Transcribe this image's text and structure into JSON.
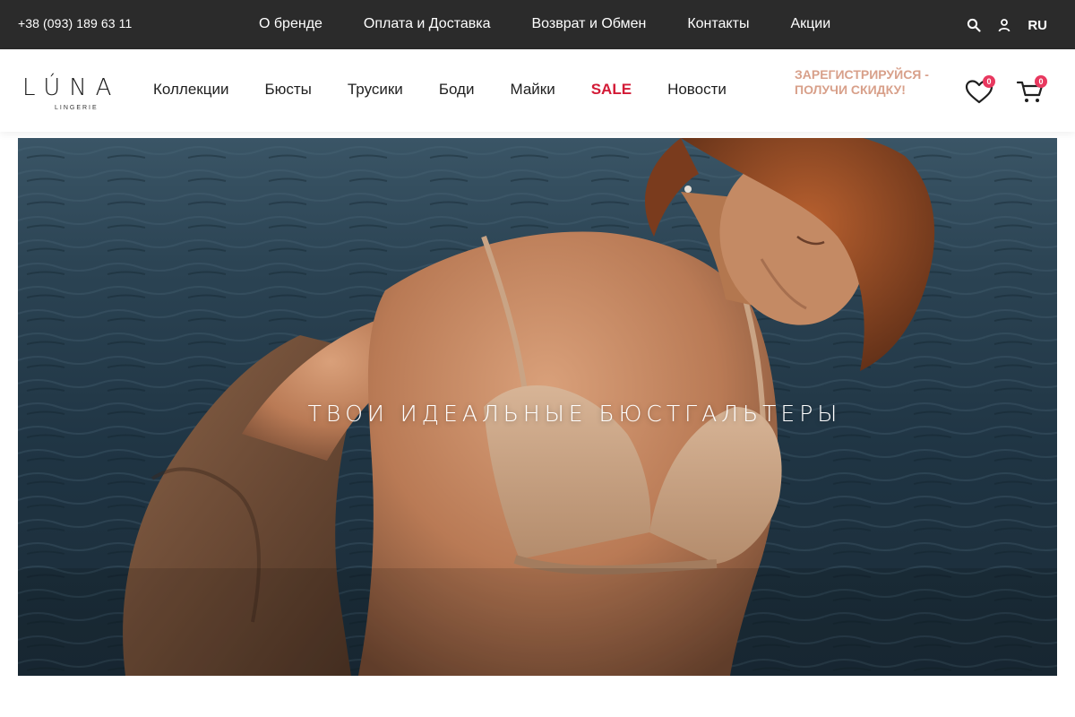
{
  "topbar": {
    "phone": "+38 (093) 189 63 11",
    "links": [
      {
        "label": "О бренде"
      },
      {
        "label": "Оплата и Доставка"
      },
      {
        "label": "Возврат и Обмен"
      },
      {
        "label": "Контакты"
      },
      {
        "label": "Акции"
      }
    ],
    "search_icon": "search-icon",
    "account_icon": "user-icon",
    "language": "RU"
  },
  "header": {
    "logo": {
      "text": "LÚNA",
      "subtitle": "LINGERIE"
    },
    "nav": [
      {
        "label": "Коллекции"
      },
      {
        "label": "Бюсты"
      },
      {
        "label": "Трусики"
      },
      {
        "label": "Боди"
      },
      {
        "label": "Майки"
      },
      {
        "label": "SALE"
      },
      {
        "label": "Новости"
      }
    ],
    "promo": "Зарегистрируйся - получи скидку!",
    "wishlist": {
      "icon": "heart-icon",
      "count": "0"
    },
    "cart": {
      "icon": "cart-icon",
      "count": "0"
    }
  },
  "hero": {
    "headline": "ТВОИ ИДЕАЛЬНЫЕ БЮСТГАЛЬТЕРЫ",
    "image": "photo-model-in-nude-bra-by-water"
  },
  "colors": {
    "topbar_bg": "#2b2b2b",
    "sale": "#d31a36",
    "promo": "#d8a08a",
    "badge": "#e8385f",
    "water": "#213443"
  }
}
